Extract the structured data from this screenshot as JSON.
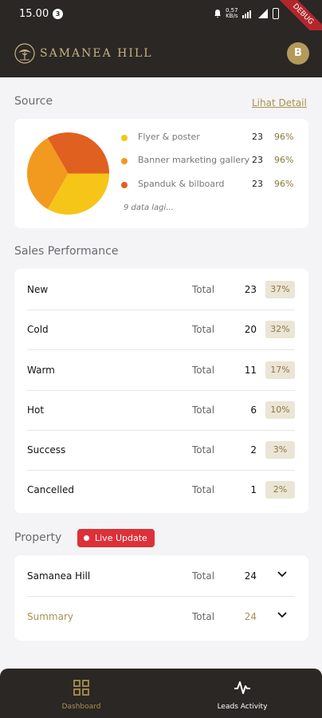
{
  "status_bar": {
    "time": "15.00",
    "notif_count": "3",
    "speed_value": "0,57",
    "speed_unit": "KB/s",
    "debug_banner": "DEBUG"
  },
  "header": {
    "brand": "SAMANEA HILL",
    "avatar_initial": "B"
  },
  "source": {
    "title": "Source",
    "detail_link": "Lihat Detail",
    "items": [
      {
        "label": "Flyer & poster",
        "count": "23",
        "percent": "96%",
        "color": "#f5c518"
      },
      {
        "label": "Banner marketing gallery",
        "count": "23",
        "percent": "96%",
        "color": "#f29a1f"
      },
      {
        "label": "Spanduk & bilboard",
        "count": "23",
        "percent": "96%",
        "color": "#e0601f"
      }
    ],
    "more": "9 data lagi..."
  },
  "chart_data": {
    "type": "pie",
    "categories": [
      "Flyer & poster",
      "Banner marketing gallery",
      "Spanduk & bilboard"
    ],
    "values": [
      23,
      23,
      23
    ],
    "colors": [
      "#f5c518",
      "#f29a1f",
      "#e0601f"
    ],
    "title": ""
  },
  "sales": {
    "title": "Sales Performance",
    "total_label": "Total",
    "rows": [
      {
        "name": "New",
        "count": "23",
        "percent": "37%"
      },
      {
        "name": "Cold",
        "count": "20",
        "percent": "32%"
      },
      {
        "name": "Warm",
        "count": "11",
        "percent": "17%"
      },
      {
        "name": "Hot",
        "count": "6",
        "percent": "10%"
      },
      {
        "name": "Success",
        "count": "2",
        "percent": "3%"
      },
      {
        "name": "Cancelled",
        "count": "1",
        "percent": "2%"
      }
    ]
  },
  "property": {
    "title": "Property",
    "live_label": "Live Update",
    "total_label": "Total",
    "rows": [
      {
        "name": "Samanea Hill",
        "count": "24"
      },
      {
        "name": "Summary",
        "count": "24"
      }
    ]
  },
  "bottom_nav": {
    "items": [
      {
        "label": "Dashboard",
        "icon": "dashboard-grid-icon",
        "active": true
      },
      {
        "label": "Leads Activity",
        "icon": "activity-pulse-icon",
        "active": false
      }
    ]
  },
  "colors": {
    "dark": "#2a2724",
    "gold": "#a8914f",
    "live_red": "#dc3139"
  }
}
